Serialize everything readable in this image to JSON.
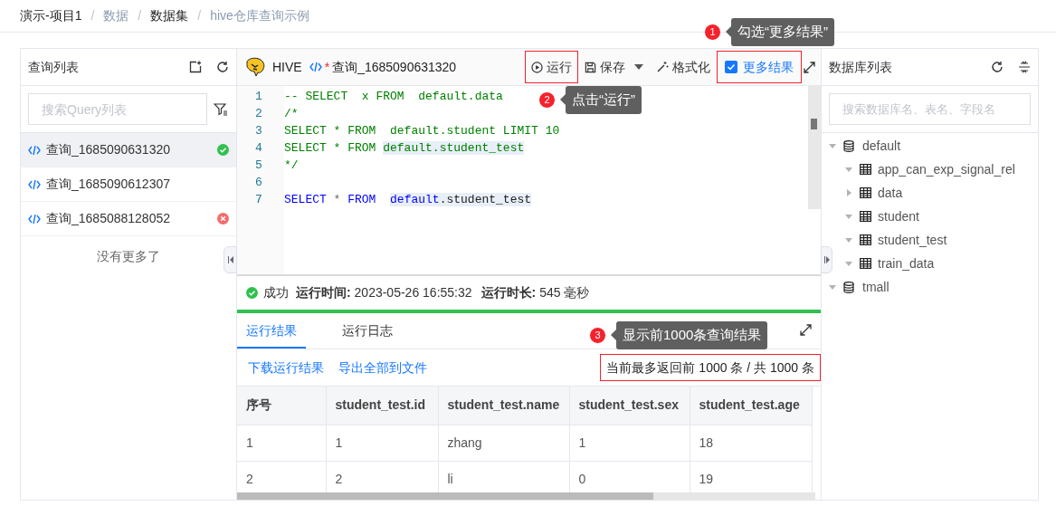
{
  "breadcrumb": [
    {
      "text": "演示-项目1",
      "muted": false
    },
    {
      "separator": "/",
      "text": "数据",
      "muted": true
    },
    {
      "separator": "/",
      "text": "数据集",
      "muted": false
    },
    {
      "separator": "/",
      "text": "hive仓库查询示例",
      "muted": true
    }
  ],
  "query_panel": {
    "title": "查询列表",
    "search": {
      "placeholder": "搜索Query列表"
    },
    "items": [
      {
        "label": "查询_1685090631320",
        "selected": true,
        "kind": "success"
      },
      {
        "label": "查询_1685090612307",
        "selected": false,
        "kind": "plain"
      },
      {
        "label": "查询_1685088128052",
        "selected": false,
        "kind": "error"
      }
    ],
    "footer": "没有更多了"
  },
  "editor": {
    "engine": "HIVE",
    "tab": {
      "modified": true,
      "modified_mark": "*",
      "title": "查询_1685090631320"
    },
    "toolbar": [
      {
        "kind": "run",
        "label": "运行",
        "highlighted": true
      },
      {
        "kind": "save",
        "label": "保存",
        "highlighted": false
      },
      {
        "kind": "format",
        "label": "格式化",
        "highlighted": false
      },
      {
        "kind": "checkbox",
        "label": "更多结果",
        "checked": true,
        "highlighted": true
      }
    ],
    "lines": [
      {
        "number": "1",
        "tokens": [
          {
            "text": "-- SELECT  x FROM  default.data",
            "kind": "comment",
            "highlighted": false
          }
        ]
      },
      {
        "number": "2",
        "tokens": [
          {
            "text": "/*",
            "kind": "comment",
            "highlighted": false
          }
        ]
      },
      {
        "number": "3",
        "tokens": [
          {
            "text": "SELECT * FROM  default.student LIMIT 10",
            "kind": "comment",
            "highlighted": false
          }
        ]
      },
      {
        "number": "4",
        "tokens": [
          {
            "text": "SELECT * FROM ",
            "kind": "comment",
            "highlighted": false
          },
          {
            "text": "default.student_test",
            "kind": "comment",
            "highlighted": true
          }
        ]
      },
      {
        "number": "5",
        "tokens": [
          {
            "text": "*/",
            "kind": "comment",
            "highlighted": false
          }
        ]
      },
      {
        "number": "6"
      },
      {
        "number": "7",
        "tokens": [
          {
            "text": "SELECT",
            "kind": "keyword",
            "highlighted": false
          },
          {
            "text": " * ",
            "kind": "operator",
            "highlighted": false
          },
          {
            "text": "FROM  ",
            "kind": "keyword",
            "highlighted": false
          },
          {
            "text": "default",
            "kind": "keyword",
            "highlighted": true
          },
          {
            "text": ".student_test",
            "kind": "plain",
            "highlighted": true
          }
        ]
      }
    ]
  },
  "status": {
    "kind": "success",
    "text": "成功",
    "fields": [
      {
        "label": "运行时间:",
        "value": "2023-05-26 16:55:32"
      },
      {
        "label": "运行时长:",
        "value": "545 毫秒"
      }
    ],
    "level": 1
  },
  "result_tabs": [
    {
      "label": "运行结果",
      "selected": true
    },
    {
      "label": "运行日志",
      "selected": false
    }
  ],
  "result_actions": [
    "下载运行结果",
    "导出全部到文件"
  ],
  "result_count": {
    "text": "当前最多返回前 1000 条 / 共 1000 条",
    "highlighted": true
  },
  "table": {
    "columns": [
      "序号",
      "student_test.id",
      "student_test.name",
      "student_test.sex",
      "student_test.age"
    ],
    "rows": [
      [
        "1",
        "1",
        "zhang",
        "1",
        "18"
      ],
      [
        "2",
        "2",
        "li",
        "0",
        "19"
      ]
    ]
  },
  "db_panel": {
    "title": "数据库列表",
    "search": {
      "placeholder": "搜索数据库名、表名、字段名"
    },
    "tree": [
      {
        "label": "default",
        "kind": "database",
        "expanded": true,
        "children": [
          {
            "label": "app_can_exp_signal_rel",
            "kind": "table",
            "expanded": true
          },
          {
            "label": "data",
            "kind": "table",
            "expanded": false
          },
          {
            "label": "student",
            "kind": "table",
            "expanded": true
          },
          {
            "label": "student_test",
            "kind": "table",
            "expanded": true
          },
          {
            "label": "train_data",
            "kind": "table",
            "expanded": true
          }
        ]
      },
      {
        "label": "tmall",
        "kind": "database",
        "expanded": true
      }
    ]
  },
  "callouts": [
    {
      "number": "1",
      "text": "勾选“更多结果”"
    },
    {
      "number": "2",
      "text": "点击“运行”"
    },
    {
      "number": "3",
      "text": "显示前1000条查询结果"
    }
  ]
}
